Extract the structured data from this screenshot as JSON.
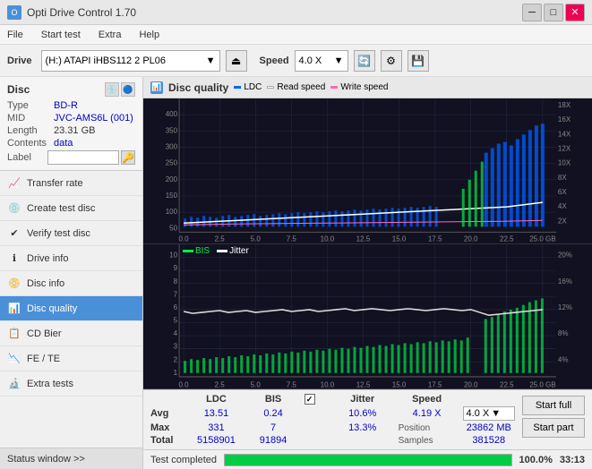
{
  "titleBar": {
    "title": "Opti Drive Control 1.70",
    "minBtn": "─",
    "maxBtn": "□",
    "closeBtn": "✕"
  },
  "menuBar": {
    "items": [
      "File",
      "Start test",
      "Extra",
      "Help"
    ]
  },
  "toolbar": {
    "driveLabel": "Drive",
    "driveValue": "(H:)  ATAPI iHBS112  2 PL06",
    "speedLabel": "Speed",
    "speedValue": "4.0 X"
  },
  "disc": {
    "label": "Disc",
    "fields": [
      {
        "label": "Type",
        "value": "BD-R"
      },
      {
        "label": "MID",
        "value": "JVC-AMS6L (001)"
      },
      {
        "label": "Length",
        "value": "23.31 GB"
      },
      {
        "label": "Contents",
        "value": "data"
      },
      {
        "label": "Label",
        "value": ""
      }
    ]
  },
  "nav": {
    "items": [
      {
        "id": "transfer-rate",
        "label": "Transfer rate",
        "icon": "📈"
      },
      {
        "id": "create-test",
        "label": "Create test disc",
        "icon": "💿"
      },
      {
        "id": "verify-test",
        "label": "Verify test disc",
        "icon": "✔"
      },
      {
        "id": "drive-info",
        "label": "Drive info",
        "icon": "ℹ"
      },
      {
        "id": "disc-info",
        "label": "Disc info",
        "icon": "📀"
      },
      {
        "id": "disc-quality",
        "label": "Disc quality",
        "icon": "📊",
        "active": true
      },
      {
        "id": "cd-bier",
        "label": "CD Bier",
        "icon": "🍺"
      },
      {
        "id": "fe-te",
        "label": "FE / TE",
        "icon": "📉"
      },
      {
        "id": "extra-tests",
        "label": "Extra tests",
        "icon": "🔬"
      }
    ]
  },
  "statusWindow": "Status window >>",
  "chartHeader": {
    "title": "Disc quality",
    "legend": [
      {
        "label": "LDC",
        "color": "#0066ff"
      },
      {
        "label": "Read speed",
        "color": "#ffffff"
      },
      {
        "label": "Write speed",
        "color": "#ff69b4"
      }
    ]
  },
  "chart1": {
    "yMax": 400,
    "yLabels": [
      "400",
      "350",
      "300",
      "250",
      "200",
      "150",
      "100",
      "50"
    ],
    "yRightLabels": [
      "18X",
      "16X",
      "14X",
      "12X",
      "10X",
      "8X",
      "6X",
      "4X",
      "2X"
    ],
    "xLabels": [
      "0.0",
      "2.5",
      "5.0",
      "7.5",
      "10.0",
      "12.5",
      "15.0",
      "17.5",
      "20.0",
      "22.5",
      "25.0 GB"
    ]
  },
  "chart2": {
    "yMax": 10,
    "yLabels": [
      "10",
      "9",
      "8",
      "7",
      "6",
      "5",
      "4",
      "3",
      "2",
      "1"
    ],
    "yRightLabels": [
      "20%",
      "16%",
      "12%",
      "8%",
      "4%"
    ],
    "legend": [
      {
        "label": "BIS",
        "color": "#00ff88"
      },
      {
        "label": "Jitter",
        "color": "#ffffff"
      }
    ],
    "xLabels": [
      "0.0",
      "2.5",
      "5.0",
      "7.5",
      "10.0",
      "12.5",
      "15.0",
      "17.5",
      "20.0",
      "22.5",
      "25.0 GB"
    ]
  },
  "stats": {
    "columns": [
      "",
      "LDC",
      "BIS",
      "",
      "Jitter",
      "Speed",
      ""
    ],
    "rows": [
      {
        "label": "Avg",
        "ldc": "13.51",
        "bis": "0.24",
        "jitter": "10.6%",
        "speed": "4.19 X",
        "speedTarget": "4.0 X"
      },
      {
        "label": "Max",
        "ldc": "331",
        "bis": "7",
        "jitter": "13.3%",
        "position": "23862 MB"
      },
      {
        "label": "Total",
        "ldc": "5158901",
        "bis": "91894",
        "jitter": "",
        "samples": "381528"
      }
    ],
    "jitterChecked": true,
    "startFull": "Start full",
    "startPart": "Start part"
  },
  "progress": {
    "percent": 100,
    "percentText": "100.0%",
    "statusText": "Test completed",
    "time": "33:13"
  }
}
